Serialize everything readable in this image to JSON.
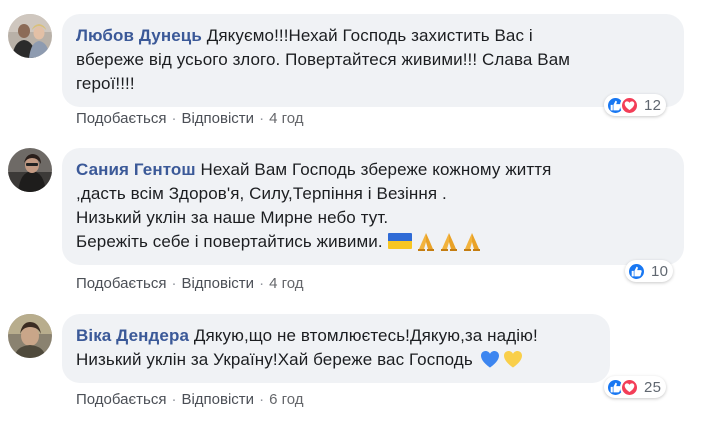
{
  "comments": [
    {
      "author": "Любов Дунець",
      "lines": [
        "Дякуємо!!!Нехай Господь захистить Вас і",
        "вбереже від усього злого. Повертайтеся живими!!! Слава Вам",
        "герої!!!!"
      ],
      "reaction_count": "12",
      "reactions": [
        "like-icon",
        "love-icon"
      ],
      "like_label": "Подобається",
      "reply_label": "Відповісти",
      "time": "4 год"
    },
    {
      "author": "Сания Гентош",
      "lines": [
        "Нехай Вам Господь збереже кожному життя",
        ",дасть всім Здоров'я, Силу,Терпіння і Везіння .",
        "Низький уклін за наше Мирне небо тут.",
        "Бережіть себе і повертайтись живими."
      ],
      "emojis": [
        "ukraine-flag-icon",
        "folded-hands-icon",
        "folded-hands-icon",
        "folded-hands-icon"
      ],
      "reaction_count": "10",
      "reactions": [
        "like-icon"
      ],
      "like_label": "Подобається",
      "reply_label": "Відповісти",
      "time": "4 год"
    },
    {
      "author": "Віка Дендера",
      "lines": [
        "Дякую,що не втомлюєтесь!Дякую,за надію!",
        "Низький уклін за Україну!Хай береже вас Господь"
      ],
      "emojis": [
        "blue-heart-icon",
        "yellow-heart-icon"
      ],
      "reaction_count": "25",
      "reactions": [
        "like-icon",
        "love-icon"
      ],
      "like_label": "Подобається",
      "reply_label": "Відповісти",
      "time": "6 год"
    }
  ],
  "separator": "·",
  "colors": {
    "author": "#3b5998",
    "bubble": "#f0f2f5",
    "like": "#1877f2",
    "love": "#f33e58",
    "flag_blue": "#2f6bd6",
    "flag_yellow": "#f7c623"
  }
}
